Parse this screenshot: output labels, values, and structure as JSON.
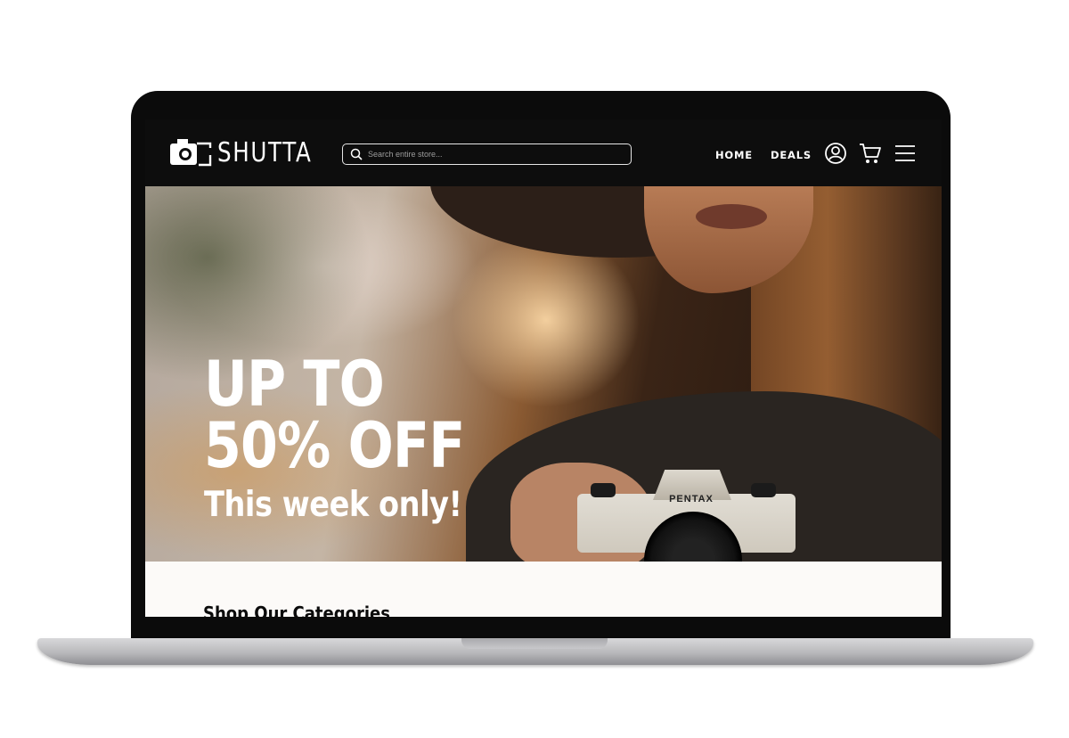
{
  "brand": {
    "name": "SHUTTA",
    "logo": "camera-logo-icon"
  },
  "search": {
    "placeholder": "Search entire store...",
    "icon": "search-icon"
  },
  "nav": [
    {
      "label": "HOME"
    },
    {
      "label": "DEALS"
    }
  ],
  "header_icons": [
    "account-icon",
    "cart-icon",
    "menu-icon"
  ],
  "hero": {
    "line1": "UP TO",
    "line2": "50% OFF",
    "subline": "This week only!",
    "camera_brand": "PENTAX"
  },
  "categories": {
    "title": "Shop Our Categories"
  },
  "colors": {
    "header_bg": "#0d0d0d",
    "text_light": "#ffffff",
    "content_bg": "#fcfaf8"
  }
}
